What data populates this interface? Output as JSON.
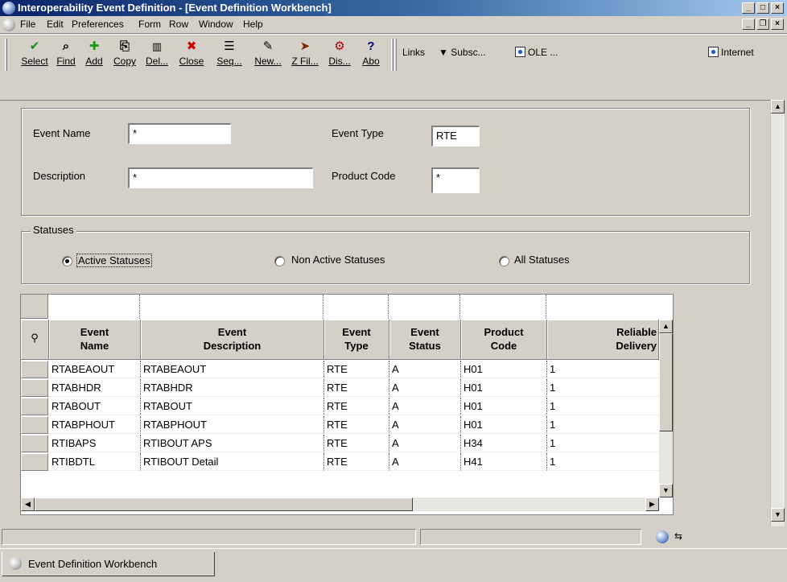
{
  "window": {
    "title": "Interoperability Event Definition - [Event Definition Workbench]"
  },
  "menu": [
    "File",
    "Edit",
    "Preferences",
    "Form",
    "Row",
    "Window",
    "Help"
  ],
  "toolbar": {
    "buttons": [
      {
        "label": "Select",
        "icon": "checkmark-icon",
        "glyph": "✔",
        "color": "#1a8a1a"
      },
      {
        "label": "Find",
        "icon": "find-icon",
        "glyph": "⌕",
        "color": "#000000"
      },
      {
        "label": "Add",
        "icon": "plus-icon",
        "glyph": "✚",
        "color": "#1a9a1a"
      },
      {
        "label": "Copy",
        "icon": "copy-icon",
        "glyph": "⎘",
        "color": "#000000"
      },
      {
        "label": "Del...",
        "icon": "trash-icon",
        "glyph": "🗑",
        "color": "#000000"
      },
      {
        "label": "Close",
        "icon": "close-x-icon",
        "glyph": "✖",
        "color": "#cc0000"
      },
      {
        "label": "Seq...",
        "icon": "sequence-icon",
        "glyph": "☰",
        "color": "#000000"
      },
      {
        "label": "New...",
        "icon": "new-icon",
        "glyph": "✎",
        "color": "#000000"
      },
      {
        "label": "Z Fil...",
        "icon": "zfilter-icon",
        "glyph": "➤",
        "color": "#7a2a00"
      },
      {
        "label": "Dis...",
        "icon": "display-icon",
        "glyph": "⚙",
        "color": "#b00000"
      },
      {
        "label": "Abo",
        "icon": "about-help-icon",
        "glyph": "?",
        "color": "#000080"
      }
    ],
    "links_label": "Links",
    "subsc_label": "Subsc...",
    "ole_label": "OLE ...",
    "internet_label": "Internet"
  },
  "form": {
    "event_name_label": "Event Name",
    "event_name_value": "*",
    "event_type_label": "Event Type",
    "event_type_value": "RTE",
    "description_label": "Description",
    "description_value": "*",
    "product_code_label": "Product Code",
    "product_code_value": "*"
  },
  "statuses": {
    "label": "Statuses",
    "options": [
      "Active Statuses",
      "Non Active Statuses",
      "All Statuses"
    ],
    "selected": "Active Statuses"
  },
  "grid": {
    "columns": [
      {
        "line1": "Event",
        "line2": "Name"
      },
      {
        "line1": "Event",
        "line2": "Description"
      },
      {
        "line1": "Event",
        "line2": "Type"
      },
      {
        "line1": "Event",
        "line2": "Status"
      },
      {
        "line1": "Product",
        "line2": "Code"
      },
      {
        "line1": "Reliable",
        "line2": "Delivery"
      }
    ],
    "rows": [
      [
        "RTABEAOUT",
        "RTABEAOUT",
        "RTE",
        "A",
        "H01",
        "1"
      ],
      [
        "RTABHDR",
        "RTABHDR",
        "RTE",
        "A",
        "H01",
        "1"
      ],
      [
        "RTABOUT",
        "RTABOUT",
        "RTE",
        "A",
        "H01",
        "1"
      ],
      [
        "RTABPHOUT",
        "RTABPHOUT",
        "RTE",
        "A",
        "H01",
        "1"
      ],
      [
        "RTIBAPS",
        "RTIBOUT APS",
        "RTE",
        "A",
        "H34",
        "1"
      ],
      [
        "RTIBDTL",
        "RTIBOUT Detail",
        "RTE",
        "A",
        "H41",
        "1"
      ]
    ]
  },
  "taskbar": {
    "tab_label": "Event Definition Workbench"
  }
}
